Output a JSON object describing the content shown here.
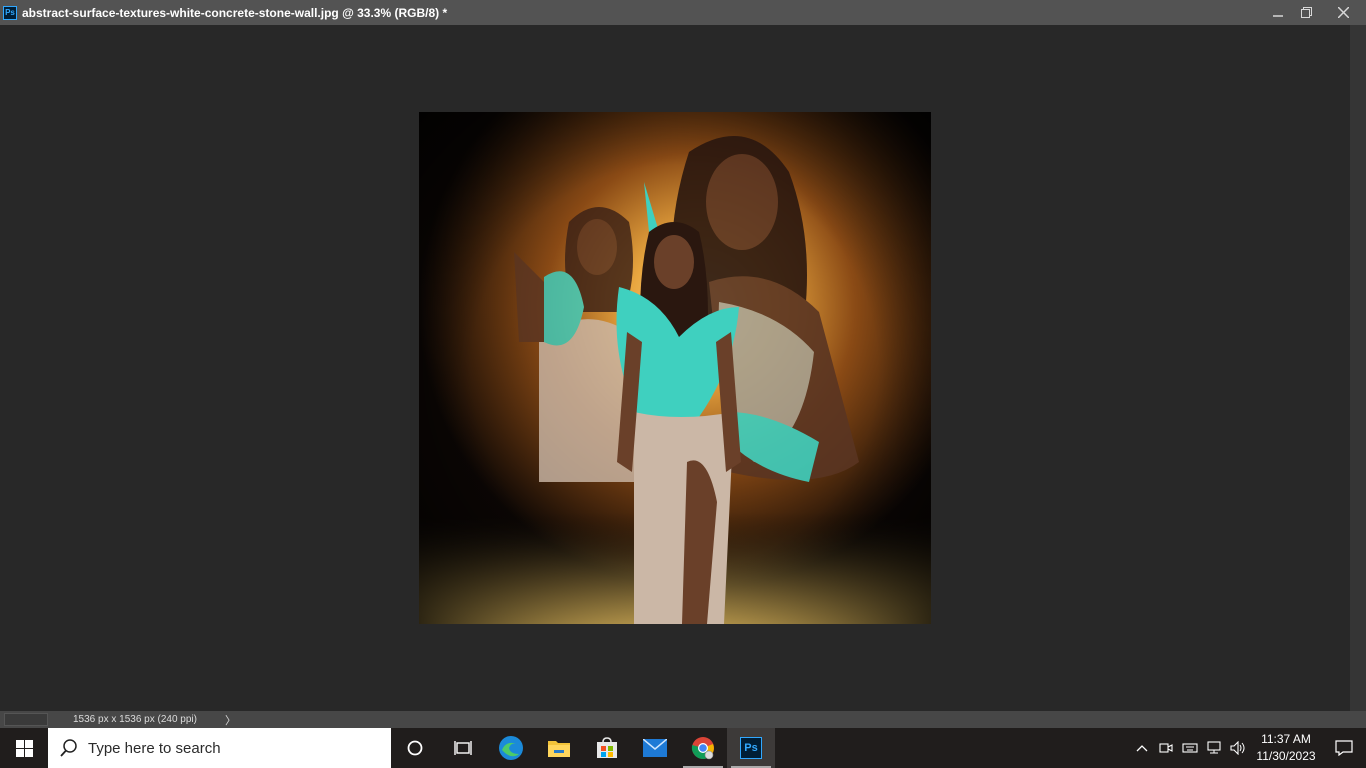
{
  "app": {
    "badge": "Ps",
    "document_title": "abstract-surface-textures-white-concrete-stone-wall.jpg @ 33.3% (RGB/8) *"
  },
  "window_controls": [
    "minimize-icon",
    "restore-icon",
    "close-icon"
  ],
  "canvas": {
    "colors": {
      "glow": "#f4b54a",
      "deep": "#120804",
      "teal": "#3fd0bf",
      "skin": "#5a3522",
      "gown": "#cbb7a6"
    }
  },
  "status": {
    "doc_info": "1536 px x 1536 px (240 ppi)",
    "arrow": "〉"
  },
  "taskbar": {
    "search_placeholder": "Type here to search",
    "apps": [
      "cortana-icon",
      "task-view-icon",
      "edge-icon",
      "file-explorer-icon",
      "store-icon",
      "mail-icon",
      "chrome-icon",
      "photoshop-icon"
    ],
    "photoshop_label": "Ps",
    "time": "11:37 AM",
    "date": "11/30/2023"
  }
}
